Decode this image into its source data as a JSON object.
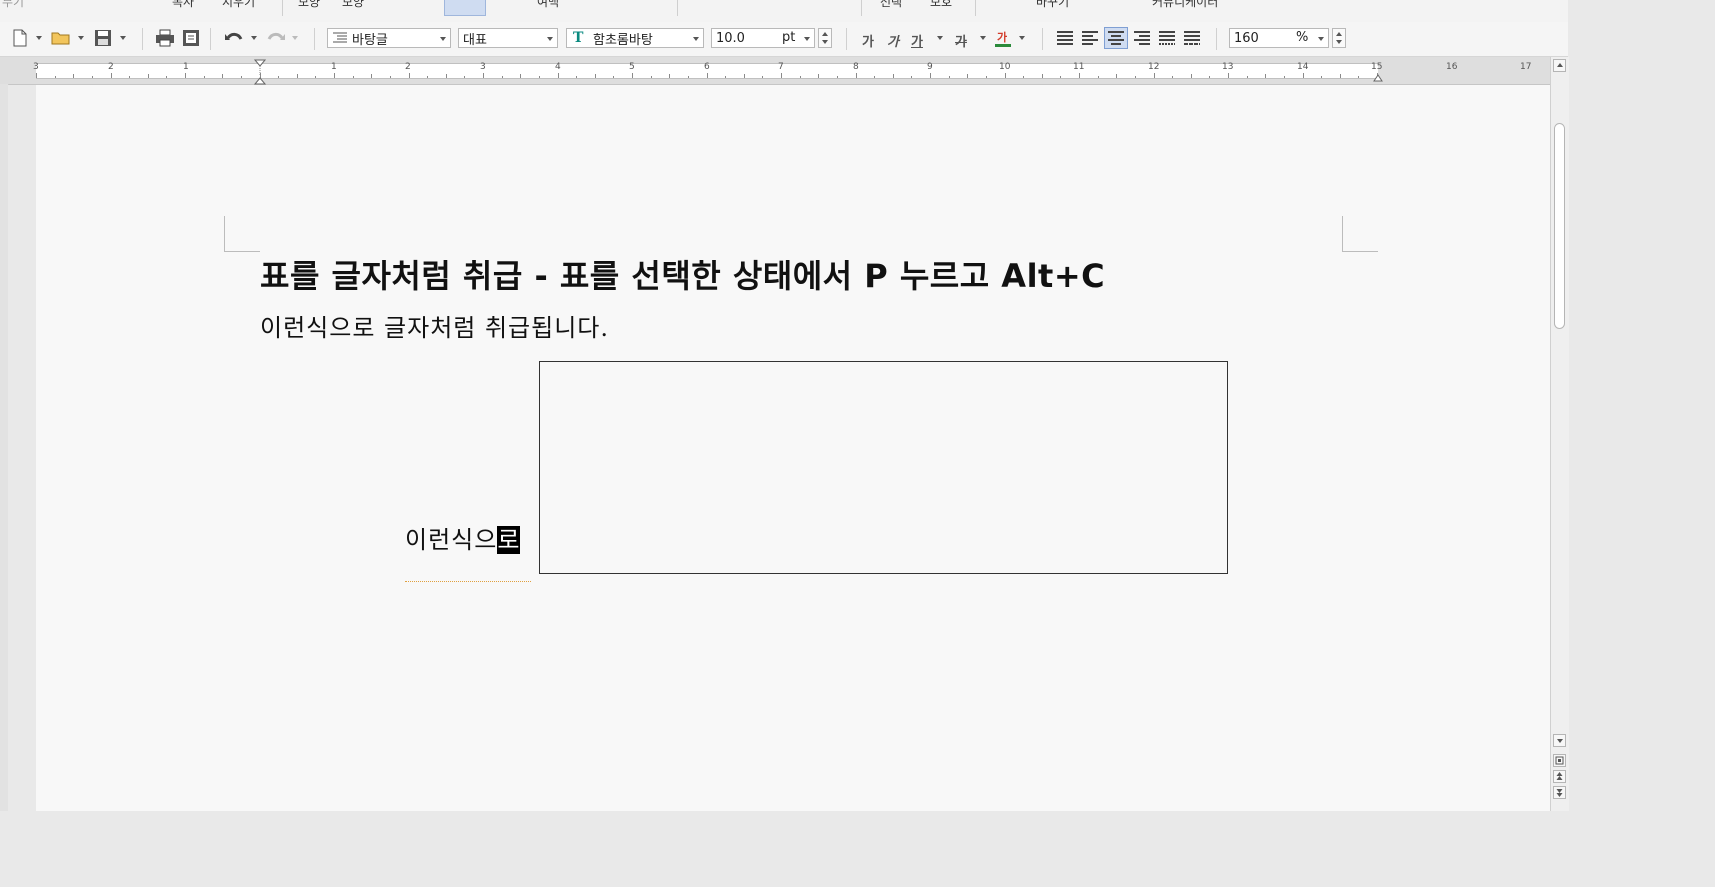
{
  "ribbon": {
    "labels": [
      "무기",
      "복사",
      "지우기",
      "모양",
      "모양",
      "여백",
      "선택",
      "보호",
      "바꾸기",
      "커뮤니케이터"
    ]
  },
  "toolbar": {
    "style_name": "바탕글",
    "language": "대표",
    "font_name": "함초롬바탕",
    "font_size": "10.0",
    "font_unit": "pt",
    "bold_label": "가",
    "italic_label": "가",
    "underline_label": "가",
    "strike_label": "가",
    "color_label": "가",
    "zoom": "160",
    "zoom_unit": "%",
    "font_color": "#d23b2a",
    "icons": [
      "new-document-icon",
      "open-folder-icon",
      "save-icon",
      "print-icon",
      "preview-icon",
      "undo-icon",
      "redo-icon",
      "paragraph-style-icon",
      "truetype-font-icon",
      "align-justify-icon",
      "align-left-icon",
      "align-center-icon",
      "align-right-icon",
      "distribute-icon",
      "divide-icon"
    ]
  },
  "ruler": {
    "numbers": [
      "3",
      "2",
      "1",
      "1",
      "1",
      "2",
      "3",
      "4",
      "5",
      "6",
      "7",
      "8",
      "9",
      "10",
      "11",
      "12",
      "13",
      "14",
      "15",
      "16",
      "17"
    ]
  },
  "document": {
    "heading": "표를 글자처럼 취급 - 표를 선택한 상태에서 P 누르고 Alt+C",
    "body_line": "이런식으로 글자처럼 취급됩니다.",
    "inline_text_before": "이런식으",
    "inline_text_cursor": "로"
  }
}
